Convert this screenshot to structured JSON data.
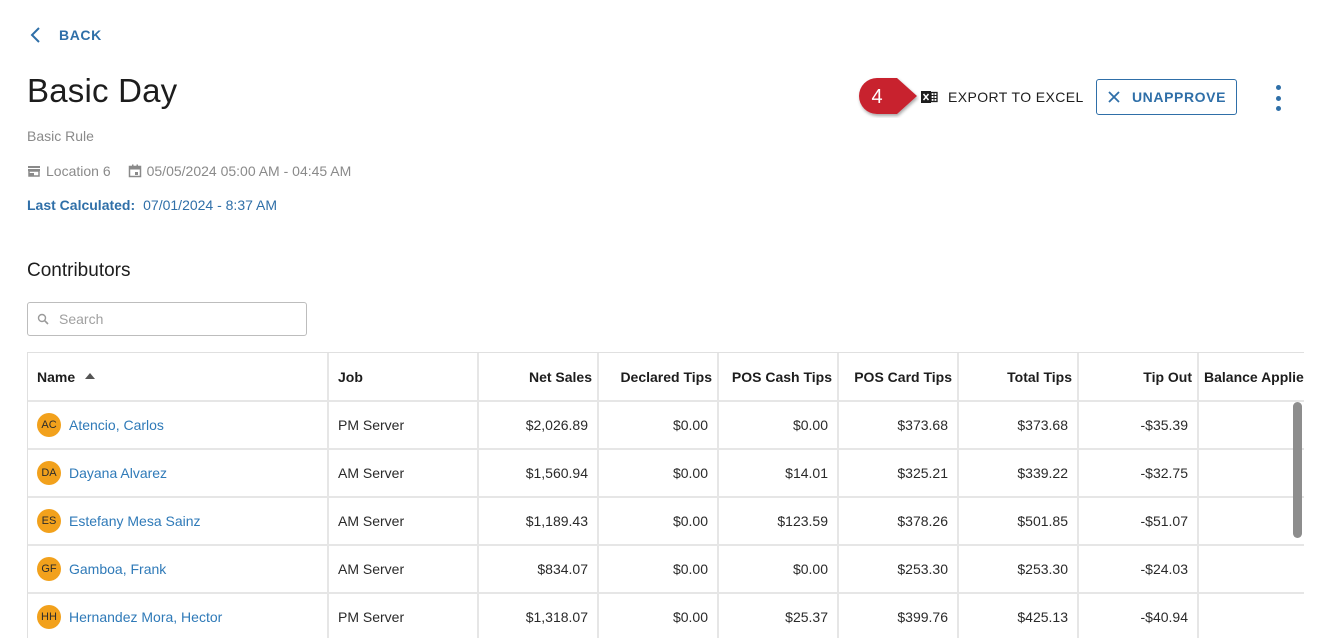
{
  "nav": {
    "back_label": "BACK"
  },
  "header": {
    "title": "Basic Day",
    "subtitle": "Basic Rule",
    "location": "Location 6",
    "date_range": "05/05/2024 05:00 AM - 04:45 AM",
    "last_calculated_label": "Last Calculated:",
    "last_calculated_value": "07/01/2024 - 8:37 AM"
  },
  "actions": {
    "step_badge": "4",
    "export_label": "EXPORT TO EXCEL",
    "unapprove_label": "UNAPPROVE"
  },
  "contributors": {
    "title": "Contributors",
    "search_placeholder": "Search",
    "columns": [
      "Name",
      "Job",
      "Net Sales",
      "Declared Tips",
      "POS Cash Tips",
      "POS Card Tips",
      "Total Tips",
      "Tip Out",
      "Balance Applied"
    ],
    "rows": [
      {
        "initials": "AC",
        "name": "Atencio, Carlos",
        "job": "PM Server",
        "net_sales": "$2,026.89",
        "declared_tips": "$0.00",
        "pos_cash_tips": "$0.00",
        "pos_card_tips": "$373.68",
        "total_tips": "$373.68",
        "tip_out": "-$35.39",
        "balance_applied": ""
      },
      {
        "initials": "DA",
        "name": "Dayana Alvarez",
        "job": "AM Server",
        "net_sales": "$1,560.94",
        "declared_tips": "$0.00",
        "pos_cash_tips": "$14.01",
        "pos_card_tips": "$325.21",
        "total_tips": "$339.22",
        "tip_out": "-$32.75",
        "balance_applied": ""
      },
      {
        "initials": "ES",
        "name": "Estefany Mesa Sainz",
        "job": "AM Server",
        "net_sales": "$1,189.43",
        "declared_tips": "$0.00",
        "pos_cash_tips": "$123.59",
        "pos_card_tips": "$378.26",
        "total_tips": "$501.85",
        "tip_out": "-$51.07",
        "balance_applied": ""
      },
      {
        "initials": "GF",
        "name": "Gamboa, Frank",
        "job": "AM Server",
        "net_sales": "$834.07",
        "declared_tips": "$0.00",
        "pos_cash_tips": "$0.00",
        "pos_card_tips": "$253.30",
        "total_tips": "$253.30",
        "tip_out": "-$24.03",
        "balance_applied": ""
      },
      {
        "initials": "HH",
        "name": "Hernandez Mora, Hector",
        "job": "PM Server",
        "net_sales": "$1,318.07",
        "declared_tips": "$0.00",
        "pos_cash_tips": "$25.37",
        "pos_card_tips": "$399.76",
        "total_tips": "$425.13",
        "tip_out": "-$40.94",
        "balance_applied": ""
      }
    ]
  },
  "colors": {
    "accent": "#2f6fa8",
    "link": "#2f7ab8",
    "avatar": "#f2a11c",
    "step_badge": "#c8202f"
  },
  "icons": {
    "back": "chevron-left-icon",
    "location": "store-icon",
    "date": "calendar-icon",
    "export": "excel-icon",
    "unapprove": "close-icon",
    "more": "more-vertical-icon",
    "search": "search-icon",
    "sort": "sort-ascending-icon"
  }
}
